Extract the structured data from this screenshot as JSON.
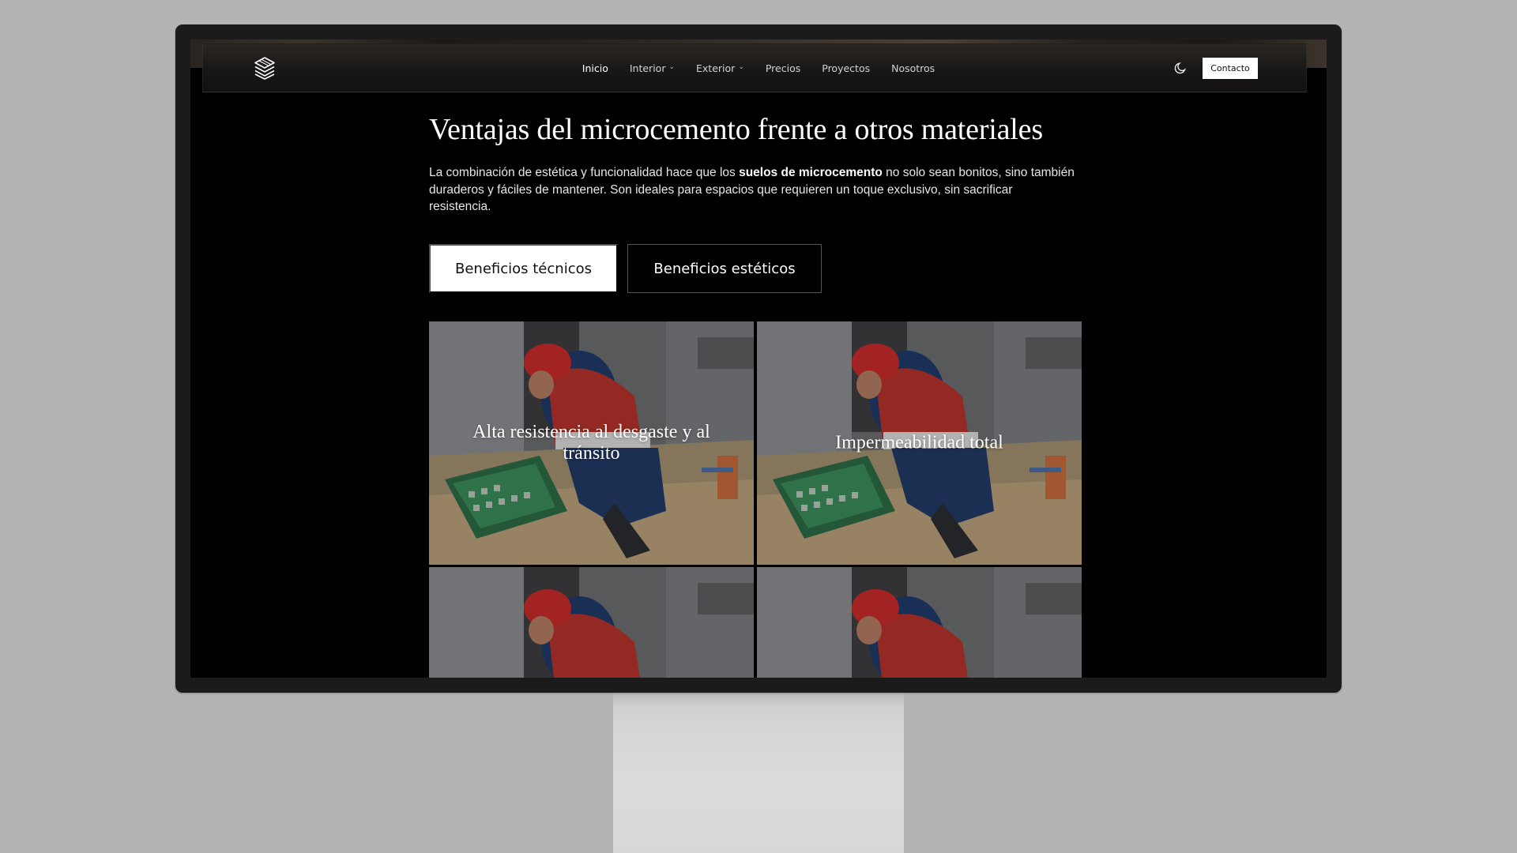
{
  "nav": {
    "items": [
      {
        "label": "Inicio",
        "dropdown": false,
        "active": true
      },
      {
        "label": "Interior",
        "dropdown": true,
        "active": false
      },
      {
        "label": "Exterior",
        "dropdown": true,
        "active": false
      },
      {
        "label": "Precios",
        "dropdown": false,
        "active": false
      },
      {
        "label": "Proyectos",
        "dropdown": false,
        "active": false
      },
      {
        "label": "Nosotros",
        "dropdown": false,
        "active": false
      }
    ],
    "contact_label": "Contacto",
    "logo_icon": "layers-logo-icon",
    "theme_icon": "moon-icon"
  },
  "hero": {
    "title": "Ventajas del microcemento frente a otros materiales",
    "intro_before": "La combinación de estética y funcionalidad hace que los ",
    "intro_bold": "suelos de microcemento",
    "intro_after": " no solo sean bonitos, sino también duraderos y fáciles de mantener. Son ideales para espacios que requieren un toque exclusivo, sin sacrificar resistencia."
  },
  "tabs": [
    {
      "label": "Beneficios técnicos",
      "selected": true
    },
    {
      "label": "Beneficios estéticos",
      "selected": false
    }
  ],
  "cards": [
    {
      "title": "Alta resistencia al desgaste y al tránsito"
    },
    {
      "title": "Impermeabilidad total"
    },
    {
      "title": ""
    },
    {
      "title": ""
    }
  ],
  "colors": {
    "page_bg": "#000000",
    "accent": "#ffffff",
    "desk_bg": "#b4b4b4"
  }
}
